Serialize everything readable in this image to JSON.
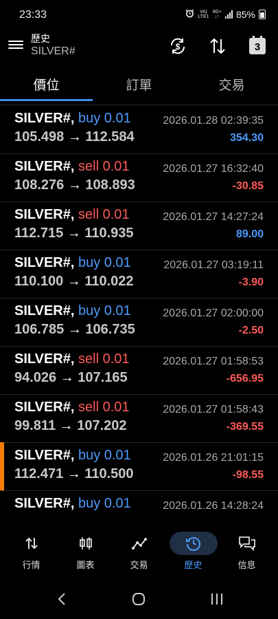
{
  "status": {
    "time": "23:33",
    "net_top": "Vo)",
    "net_bottom": "LTE1",
    "net_type": "4G+",
    "battery": "85%"
  },
  "header": {
    "title": "歷史",
    "subtitle": "SILVER#"
  },
  "tabs": [
    {
      "label": "價位"
    },
    {
      "label": "訂單"
    },
    {
      "label": "交易"
    }
  ],
  "deals": [
    {
      "symbol": "SILVER#,",
      "side": "buy 0.01",
      "open": "105.498",
      "arrow": "→",
      "close": "112.584",
      "time": "2026.01.28 02:39:35",
      "profit": "354.30"
    },
    {
      "symbol": "SILVER#,",
      "side": "sell 0.01",
      "open": "108.276",
      "arrow": "→",
      "close": "108.893",
      "time": "2026.01.27 16:32:40",
      "profit": "-30.85"
    },
    {
      "symbol": "SILVER#,",
      "side": "sell 0.01",
      "open": "112.715",
      "arrow": "→",
      "close": "110.935",
      "time": "2026.01.27 14:27:24",
      "profit": "89.00"
    },
    {
      "symbol": "SILVER#,",
      "side": "buy 0.01",
      "open": "110.100",
      "arrow": "→",
      "close": "110.022",
      "time": "2026.01.27 03:19:11",
      "profit": "-3.90"
    },
    {
      "symbol": "SILVER#,",
      "side": "buy 0.01",
      "open": "106.785",
      "arrow": "→",
      "close": "106.735",
      "time": "2026.01.27 02:00:00",
      "profit": "-2.50"
    },
    {
      "symbol": "SILVER#,",
      "side": "sell 0.01",
      "open": "94.026",
      "arrow": "→",
      "close": "107.165",
      "time": "2026.01.27 01:58:53",
      "profit": "-656.95"
    },
    {
      "symbol": "SILVER#,",
      "side": "sell 0.01",
      "open": "99.811",
      "arrow": "→",
      "close": "107.202",
      "time": "2026.01.27 01:58:43",
      "profit": "-369.55"
    },
    {
      "symbol": "SILVER#,",
      "side": "buy 0.01",
      "open": "112.471",
      "arrow": "→",
      "close": "110.500",
      "time": "2026.01.26 21:01:15",
      "profit": "-98.55"
    },
    {
      "symbol": "SILVER#,",
      "side": "buy 0.01",
      "open": "",
      "arrow": "",
      "close": "",
      "time": "2026.01.26 14:28:24",
      "profit": ""
    }
  ],
  "nav": [
    {
      "label": "行情",
      "icon": "quotes-arrows-icon"
    },
    {
      "label": "圖表",
      "icon": "candlestick-chart-icon"
    },
    {
      "label": "交易",
      "icon": "trade-line-icon"
    },
    {
      "label": "歷史",
      "icon": "history-clock-icon"
    },
    {
      "label": "信息",
      "icon": "messages-icon"
    }
  ],
  "colors": {
    "accent": "#4d9bff",
    "sell": "#ff5a5a",
    "marker": "#f57c00",
    "background": "#000000"
  }
}
